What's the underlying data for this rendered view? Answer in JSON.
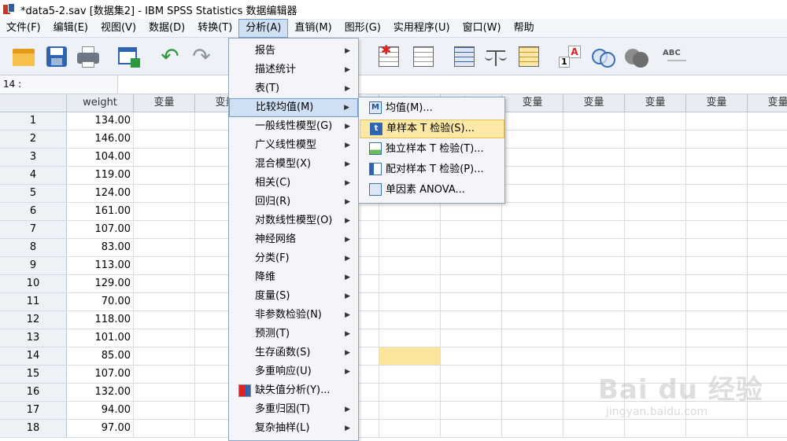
{
  "window": {
    "title": "*data5-2.sav [数据集2] - IBM SPSS Statistics 数据编辑器"
  },
  "menubar": {
    "items": [
      "文件(F)",
      "编辑(E)",
      "视图(V)",
      "数据(D)",
      "转换(T)",
      "分析(A)",
      "直销(M)",
      "图形(G)",
      "实用程序(U)",
      "窗口(W)",
      "帮助"
    ],
    "active": "分析(A)"
  },
  "toolbar": {
    "icons": [
      "open-icon",
      "save-icon",
      "print-icon",
      "recall-dialog-icon",
      "undo-icon",
      "redo-icon",
      "insert-cases-icon",
      "insert-variable-icon",
      "split-file-icon",
      "weight-cases-icon",
      "select-cases-icon",
      "value-labels-icon",
      "use-sets-icon",
      "show-all-variables-icon",
      "spell-check-icon"
    ],
    "spell_label": "ABC"
  },
  "cell_editor": {
    "reference": "14 :",
    "value": ""
  },
  "grid": {
    "columns": [
      "weight",
      "变量",
      "变量",
      "变量",
      "变量",
      "变量",
      "变量",
      "变量",
      "变量",
      "变量",
      "变量",
      "变量"
    ],
    "rows": [
      {
        "n": "1",
        "weight": "134.00"
      },
      {
        "n": "2",
        "weight": "146.00"
      },
      {
        "n": "3",
        "weight": "104.00"
      },
      {
        "n": "4",
        "weight": "119.00"
      },
      {
        "n": "5",
        "weight": "124.00"
      },
      {
        "n": "6",
        "weight": "161.00"
      },
      {
        "n": "7",
        "weight": "107.00"
      },
      {
        "n": "8",
        "weight": "83.00"
      },
      {
        "n": "9",
        "weight": "113.00"
      },
      {
        "n": "10",
        "weight": "129.00"
      },
      {
        "n": "11",
        "weight": "70.00"
      },
      {
        "n": "12",
        "weight": "118.00"
      },
      {
        "n": "13",
        "weight": "101.00"
      },
      {
        "n": "14",
        "weight": "85.00"
      },
      {
        "n": "15",
        "weight": "107.00"
      },
      {
        "n": "16",
        "weight": "132.00"
      },
      {
        "n": "17",
        "weight": "94.00"
      },
      {
        "n": "18",
        "weight": "97.00"
      }
    ],
    "highlight_color": "#fbe59b"
  },
  "analyze_menu": {
    "items": [
      {
        "label": "报告",
        "sub": true
      },
      {
        "label": "描述统计",
        "sub": true
      },
      {
        "label": "表(T)",
        "sub": true
      },
      {
        "label": "比较均值(M)",
        "sub": true,
        "active": true
      },
      {
        "label": "一般线性模型(G)",
        "sub": true
      },
      {
        "label": "广义线性模型",
        "sub": true
      },
      {
        "label": "混合模型(X)",
        "sub": true
      },
      {
        "label": "相关(C)",
        "sub": true
      },
      {
        "label": "回归(R)",
        "sub": true
      },
      {
        "label": "对数线性模型(O)",
        "sub": true
      },
      {
        "label": "神经网络",
        "sub": true
      },
      {
        "label": "分类(F)",
        "sub": true
      },
      {
        "label": "降维",
        "sub": true
      },
      {
        "label": "度量(S)",
        "sub": true
      },
      {
        "label": "非参数检验(N)",
        "sub": true
      },
      {
        "label": "预测(T)",
        "sub": true
      },
      {
        "label": "生存函数(S)",
        "sub": true
      },
      {
        "label": "多重响应(U)",
        "sub": true
      },
      {
        "label": "缺失值分析(Y)...",
        "sub": false,
        "icon": "missing-value-icon"
      },
      {
        "label": "多重归因(T)",
        "sub": true
      },
      {
        "label": "复杂抽样(L)",
        "sub": true
      }
    ]
  },
  "compare_means_submenu": {
    "items": [
      {
        "label": "均值(M)...",
        "icon": "means-icon",
        "glyph": "M"
      },
      {
        "label": "单样本 T 检验(S)...",
        "icon": "one-sample-t-test-icon",
        "glyph": "t",
        "active": true
      },
      {
        "label": "独立样本 T 检验(T)...",
        "icon": "independent-t-test-icon",
        "glyph": ""
      },
      {
        "label": "配对样本 T 检验(P)...",
        "icon": "paired-t-test-icon",
        "glyph": ""
      },
      {
        "label": "单因素 ANOVA...",
        "icon": "one-way-anova-icon",
        "glyph": ""
      }
    ]
  },
  "watermark": {
    "brand": "Bai du 经验",
    "sub": "jingyan.baidu.com"
  },
  "colors": {
    "menu_active": "#cfe0f5",
    "submenu_active": "#fde8a6",
    "header_bg": "#e8edf4"
  }
}
